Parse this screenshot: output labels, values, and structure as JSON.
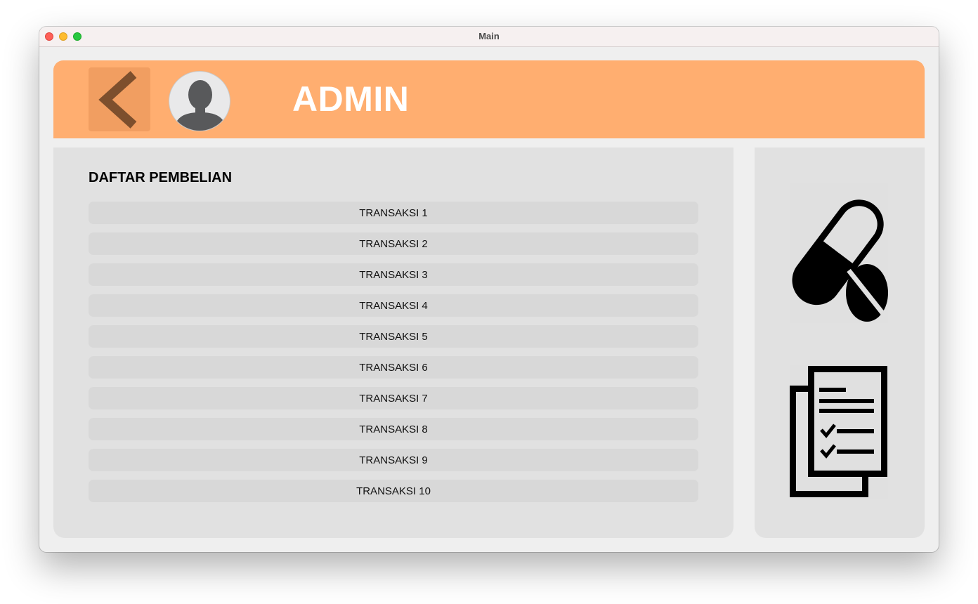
{
  "window": {
    "title": "Main"
  },
  "header": {
    "title": "ADMIN",
    "back_icon": "chevron-left-icon",
    "avatar_icon": "user-avatar-icon",
    "color": "#ffae70"
  },
  "purchases": {
    "title": "DAFTAR PEMBELIAN",
    "items": [
      {
        "label": "TRANSAKSI 1"
      },
      {
        "label": "TRANSAKSI 2"
      },
      {
        "label": "TRANSAKSI 3"
      },
      {
        "label": "TRANSAKSI 4"
      },
      {
        "label": "TRANSAKSI 5"
      },
      {
        "label": "TRANSAKSI 6"
      },
      {
        "label": "TRANSAKSI 7"
      },
      {
        "label": "TRANSAKSI 8"
      },
      {
        "label": "TRANSAKSI 9"
      },
      {
        "label": "TRANSAKSI 10"
      }
    ]
  },
  "side_menu": {
    "items": [
      {
        "icon": "medicine-pills-icon"
      },
      {
        "icon": "documents-checklist-icon"
      }
    ]
  }
}
